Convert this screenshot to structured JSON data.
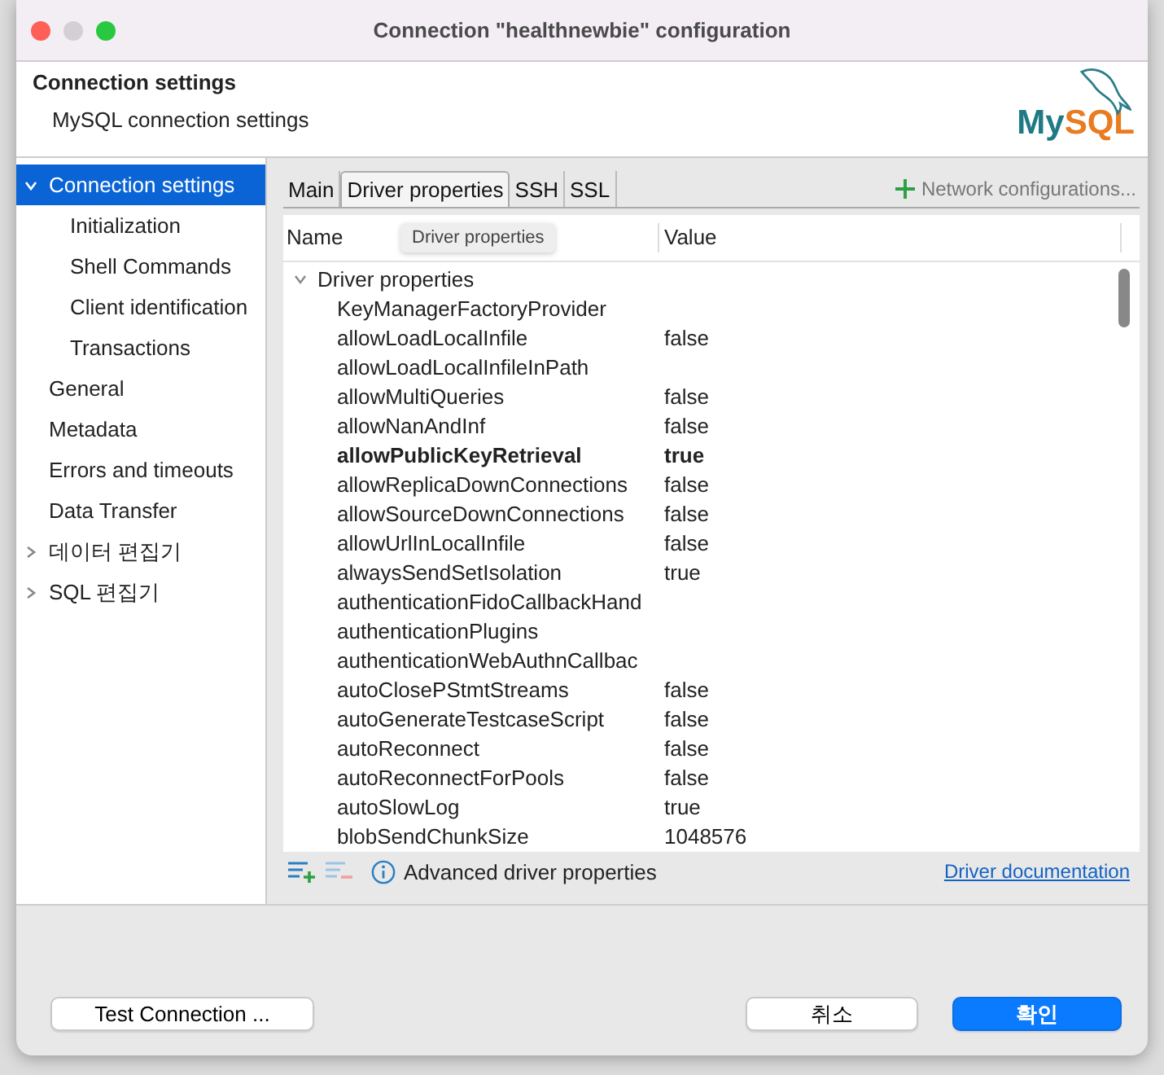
{
  "window": {
    "title": "Connection \"healthnewbie\" configuration"
  },
  "header": {
    "title": "Connection settings",
    "subtitle": "MySQL connection settings",
    "logo": [
      "My",
      "SQL"
    ]
  },
  "sidebar": {
    "items": [
      {
        "label": "Connection settings",
        "selected": true,
        "expanded": true,
        "children": [
          {
            "label": "Initialization",
            "selected": false
          },
          {
            "label": "Shell Commands",
            "selected": false
          },
          {
            "label": "Client identification",
            "selected": false
          },
          {
            "label": "Transactions",
            "selected": false
          }
        ]
      },
      {
        "label": "General",
        "selected": false
      },
      {
        "label": "Metadata",
        "selected": false
      },
      {
        "label": "Errors and timeouts",
        "selected": false
      },
      {
        "label": "Data Transfer",
        "selected": false
      },
      {
        "label": "데이터 편집기",
        "selected": false,
        "expanded": false
      },
      {
        "label": "SQL 편집기",
        "selected": false,
        "expanded": false
      }
    ]
  },
  "tabs": [
    {
      "label": "Main",
      "selected": false
    },
    {
      "label": "Driver properties",
      "selected": true
    },
    {
      "label": "SSH",
      "selected": false
    },
    {
      "label": "SSL",
      "selected": false
    }
  ],
  "network_button": {
    "label": "Network configurations..."
  },
  "tooltip": "Driver properties",
  "table": {
    "columns": [
      "Name",
      "Value"
    ],
    "groups": [
      {
        "label": "Driver properties",
        "expanded": true,
        "rows": [
          {
            "name": "KeyManagerFactoryProvider",
            "value": "",
            "modified": false
          },
          {
            "name": "allowLoadLocalInfile",
            "value": "false",
            "modified": false
          },
          {
            "name": "allowLoadLocalInfileInPath",
            "value": "",
            "modified": false
          },
          {
            "name": "allowMultiQueries",
            "value": "false",
            "modified": false
          },
          {
            "name": "allowNanAndInf",
            "value": "false",
            "modified": false
          },
          {
            "name": "allowPublicKeyRetrieval",
            "value": "true",
            "modified": true
          },
          {
            "name": "allowReplicaDownConnections",
            "value": "false",
            "modified": false
          },
          {
            "name": "allowSourceDownConnections",
            "value": "false",
            "modified": false
          },
          {
            "name": "allowUrlInLocalInfile",
            "value": "false",
            "modified": false
          },
          {
            "name": "alwaysSendSetIsolation",
            "value": "true",
            "modified": false
          },
          {
            "name": "authenticationFidoCallbackHand",
            "value": "",
            "modified": false
          },
          {
            "name": "authenticationPlugins",
            "value": "",
            "modified": false
          },
          {
            "name": "authenticationWebAuthnCallbac",
            "value": "",
            "modified": false
          },
          {
            "name": "autoClosePStmtStreams",
            "value": "false",
            "modified": false
          },
          {
            "name": "autoGenerateTestcaseScript",
            "value": "false",
            "modified": false
          },
          {
            "name": "autoReconnect",
            "value": "false",
            "modified": false
          },
          {
            "name": "autoReconnectForPools",
            "value": "false",
            "modified": false
          },
          {
            "name": "autoSlowLog",
            "value": "true",
            "modified": false
          },
          {
            "name": "blobSendChunkSize",
            "value": "1048576",
            "modified": false
          }
        ]
      }
    ]
  },
  "table_footer": {
    "info": "Advanced driver properties",
    "link": "Driver documentation"
  },
  "buttons": [
    {
      "label": "Test Connection ...",
      "kind": "test"
    },
    {
      "label": "취소",
      "kind": "cancel"
    },
    {
      "label": "확인",
      "kind": "primary"
    }
  ]
}
